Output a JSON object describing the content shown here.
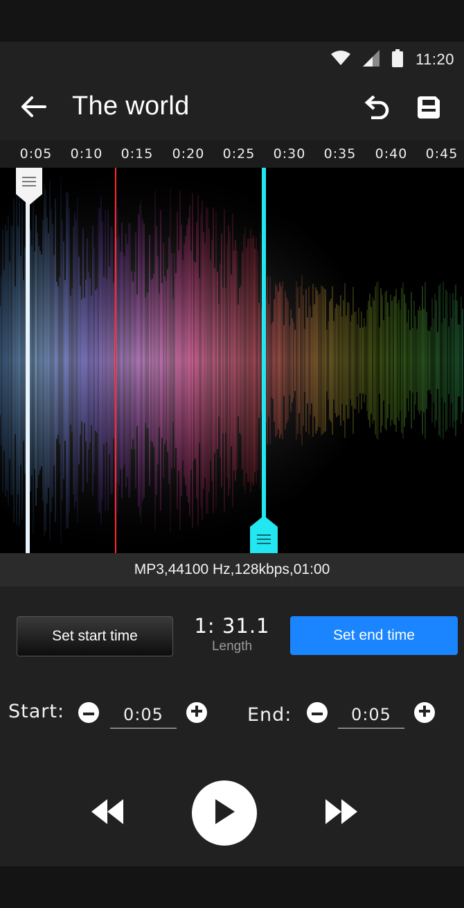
{
  "status_bar": {
    "time": "11:20",
    "icons": [
      "wifi-icon",
      "cell-signal-icon",
      "battery-icon"
    ]
  },
  "app_bar": {
    "title": "The world",
    "back_icon": "arrow-left-icon",
    "undo_icon": "undo-icon",
    "save_icon": "save-icon"
  },
  "timeline": {
    "ticks": [
      "0:05",
      "0:10",
      "0:15",
      "0:20",
      "0:25",
      "0:30",
      "0:35",
      "0:40",
      "0:45"
    ]
  },
  "file_info": "MP3,44100 Hz,128kbps,01:00",
  "selection": {
    "set_start_label": "Set start time",
    "set_end_label": "Set end time",
    "length_value": "1: 31.1",
    "length_label": "Length"
  },
  "start": {
    "label": "Start:",
    "value": "0:05"
  },
  "end": {
    "label": "End:",
    "value": "0:05"
  },
  "player": {
    "rewind_icon": "rewind-icon",
    "play_icon": "play-icon",
    "fast_forward_icon": "fast-forward-icon"
  },
  "colors": {
    "accent_blue": "#1b85ff",
    "end_marker": "#22e6f0",
    "playhead": "#ff2a2a",
    "start_marker": "#e8f2fb"
  }
}
